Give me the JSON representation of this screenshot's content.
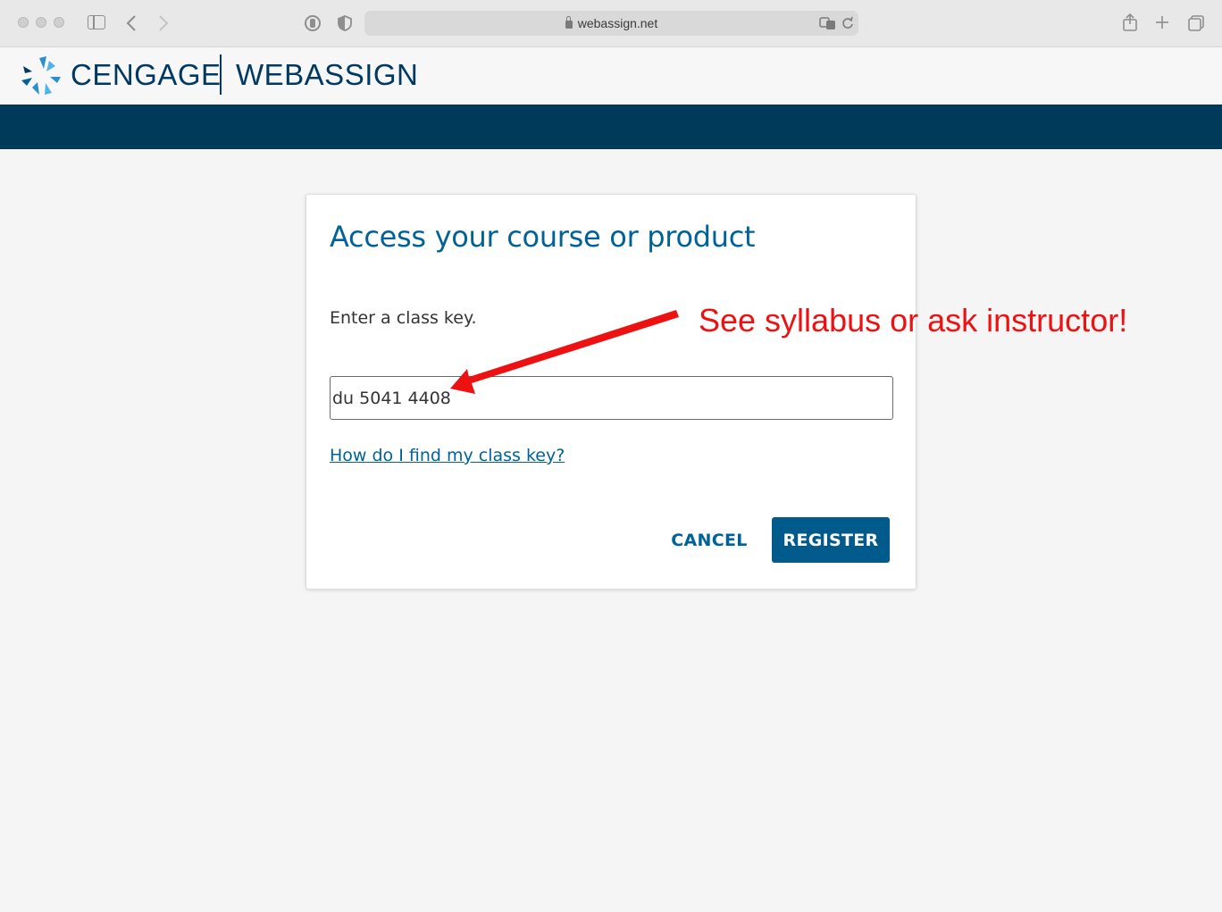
{
  "browser": {
    "url": "webassign.net"
  },
  "header": {
    "brand_primary": "CENGAGE",
    "brand_secondary": "WEBASSIGN"
  },
  "card": {
    "title": "Access your course or product",
    "prompt": "Enter a class key.",
    "class_key_value": "du 5041 4408",
    "help_link": "How do I find my class key?",
    "cancel_label": "CANCEL",
    "register_label": "REGISTER"
  },
  "annotation": {
    "text": "See syllabus or ask instructor!"
  },
  "colors": {
    "brand_navy": "#003a62",
    "nav_band": "#003a5a",
    "link_blue": "#006298",
    "button_blue": "#005a8c",
    "annotation_red": "#ee1111"
  }
}
